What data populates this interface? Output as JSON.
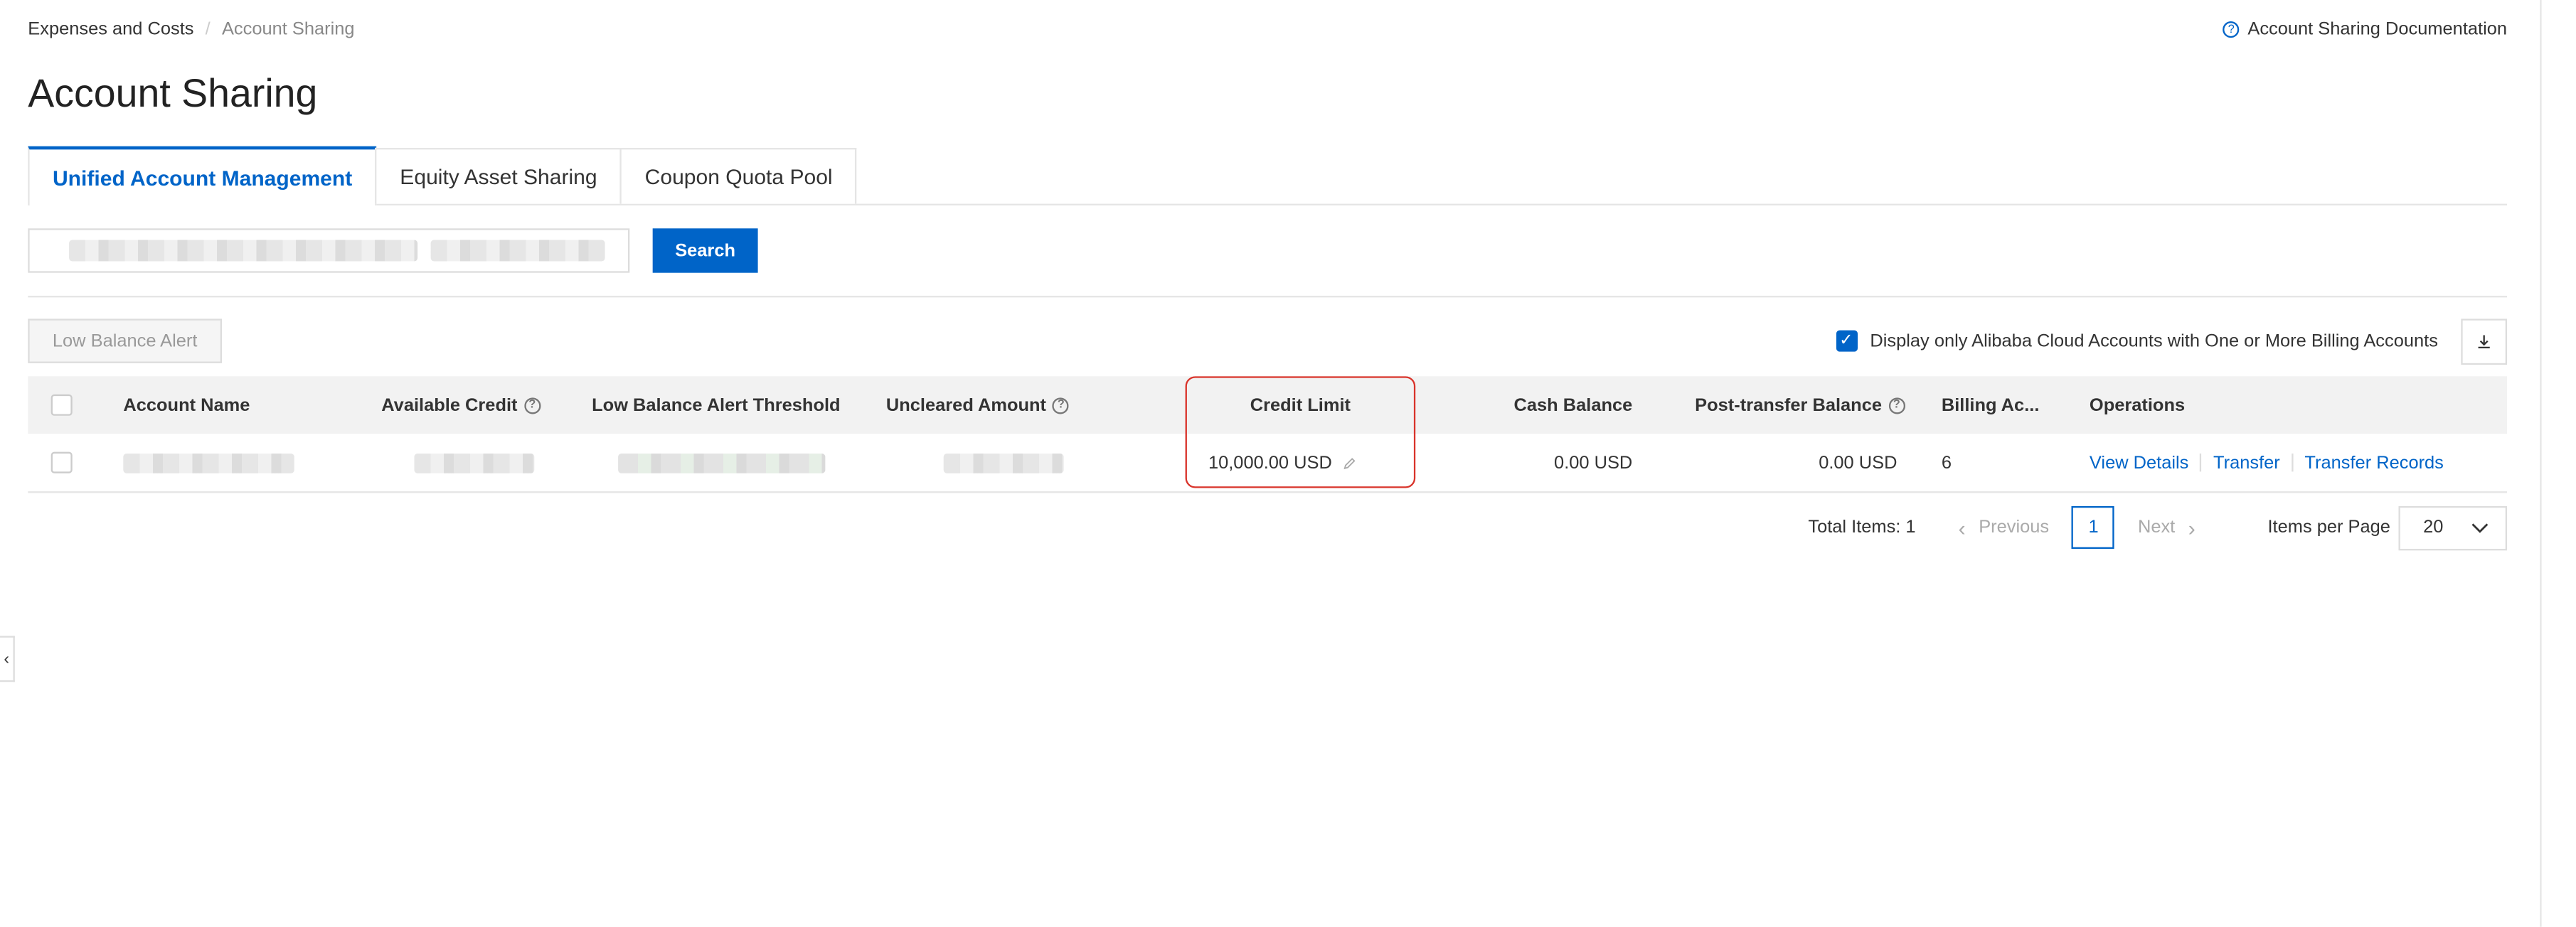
{
  "breadcrumb": {
    "parent": "Expenses and Costs",
    "separator": "/",
    "current": "Account Sharing"
  },
  "doc_link": "Account Sharing Documentation",
  "page_title": "Account Sharing",
  "tabs": [
    {
      "label": "Unified Account Management",
      "active": true
    },
    {
      "label": "Equity Asset Sharing",
      "active": false
    },
    {
      "label": "Coupon Quota Pool",
      "active": false
    }
  ],
  "search": {
    "button_label": "Search"
  },
  "toolbar": {
    "low_balance_alert_label": "Low Balance Alert",
    "filter_label": "Display only Alibaba Cloud Accounts with One or More Billing Accounts",
    "filter_checked": true
  },
  "table": {
    "headers": {
      "account_name": "Account Name",
      "available_credit": "Available Credit",
      "low_balance_threshold": "Low Balance Alert Threshold",
      "uncleared_amount": "Uncleared Amount",
      "credit_limit": "Credit Limit",
      "cash_balance": "Cash Balance",
      "post_transfer_balance": "Post-transfer Balance",
      "billing_accounts": "Billing Ac...",
      "operations": "Operations"
    },
    "rows": [
      {
        "credit_limit": "10,000.00 USD",
        "cash_balance": "0.00 USD",
        "post_transfer_balance": "0.00 USD",
        "billing_accounts": "6",
        "ops": {
          "view_details": "View Details",
          "transfer": "Transfer",
          "transfer_records": "Transfer Records"
        }
      }
    ]
  },
  "pagination": {
    "total_label": "Total Items: 1",
    "previous": "Previous",
    "current_page": "1",
    "next": "Next",
    "per_page_label": "Items per Page",
    "per_page_value": "20"
  },
  "colors": {
    "accent": "#0064c8",
    "highlight": "#d9342b"
  }
}
